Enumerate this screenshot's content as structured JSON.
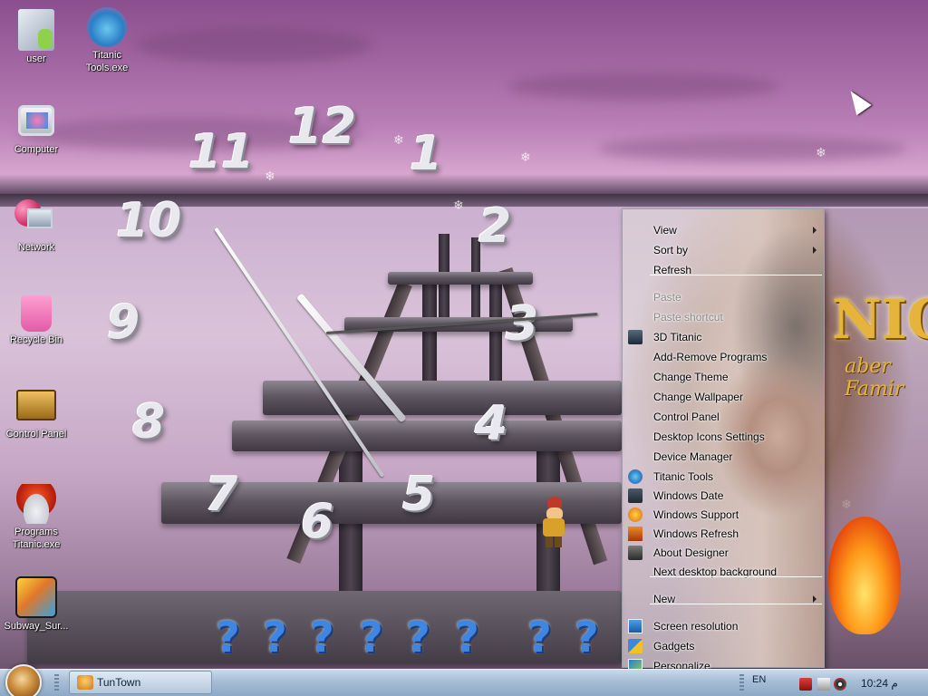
{
  "desktop": {
    "icons": [
      {
        "label": "user",
        "icon": "folder-user-icon"
      },
      {
        "label": "Titanic Tools.exe",
        "icon": "titanic-tools-icon"
      },
      {
        "label": "Computer",
        "icon": "computer-icon"
      },
      {
        "label": "Network",
        "icon": "network-icon"
      },
      {
        "label": "Recycle Bin",
        "icon": "recycle-bin-icon"
      },
      {
        "label": "Control Panel",
        "icon": "control-panel-icon"
      },
      {
        "label": "Programs Titanic.exe",
        "icon": "programs-icon"
      },
      {
        "label": "Subway_Sur...",
        "icon": "subway-surfers-icon"
      }
    ],
    "clock_numbers": [
      "12",
      "1",
      "2",
      "3",
      "4",
      "5",
      "6",
      "7",
      "8",
      "9",
      "10",
      "11"
    ],
    "question_marks": [
      "?",
      "?",
      "?",
      "?",
      "?",
      "?",
      "?",
      "?"
    ],
    "art_text": {
      "big": "NIC",
      "small": "aber Famir"
    }
  },
  "context_menu": {
    "items": [
      {
        "label": "View",
        "submenu": true,
        "disabled": false,
        "icon": ""
      },
      {
        "label": "Sort by",
        "submenu": true,
        "disabled": false,
        "icon": ""
      },
      {
        "label": "Refresh",
        "submenu": false,
        "disabled": false,
        "icon": ""
      },
      {
        "label": "Paste",
        "submenu": false,
        "disabled": true,
        "icon": ""
      },
      {
        "label": "Paste shortcut",
        "submenu": false,
        "disabled": true,
        "icon": ""
      },
      {
        "label": "3D Titanic",
        "submenu": false,
        "disabled": false,
        "icon": "titanic-3d-icon"
      },
      {
        "label": "Add-Remove Programs",
        "submenu": false,
        "disabled": false,
        "icon": ""
      },
      {
        "label": "Change Theme",
        "submenu": false,
        "disabled": false,
        "icon": ""
      },
      {
        "label": "Change Wallpaper",
        "submenu": false,
        "disabled": false,
        "icon": ""
      },
      {
        "label": "Control Panel",
        "submenu": false,
        "disabled": false,
        "icon": ""
      },
      {
        "label": "Desktop Icons Settings",
        "submenu": false,
        "disabled": false,
        "icon": ""
      },
      {
        "label": "Device Manager",
        "submenu": false,
        "disabled": false,
        "icon": ""
      },
      {
        "label": "Titanic Tools",
        "submenu": false,
        "disabled": false,
        "icon": "titanic-tools-icon"
      },
      {
        "label": "Windows Date",
        "submenu": false,
        "disabled": false,
        "icon": "windows-date-icon"
      },
      {
        "label": "Windows Support",
        "submenu": false,
        "disabled": false,
        "icon": "windows-support-icon"
      },
      {
        "label": "Windows Refresh",
        "submenu": false,
        "disabled": false,
        "icon": "windows-refresh-icon"
      },
      {
        "label": "About Designer",
        "submenu": false,
        "disabled": false,
        "icon": "about-designer-icon"
      },
      {
        "label": "Next desktop background",
        "submenu": false,
        "disabled": false,
        "icon": ""
      },
      {
        "label": "New",
        "submenu": true,
        "disabled": false,
        "icon": ""
      },
      {
        "label": "Screen resolution",
        "submenu": false,
        "disabled": false,
        "icon": "screen-resolution-icon"
      },
      {
        "label": "Gadgets",
        "submenu": false,
        "disabled": false,
        "icon": "gadgets-icon"
      },
      {
        "label": "Personalize",
        "submenu": false,
        "disabled": false,
        "icon": "personalize-icon"
      }
    ]
  },
  "taskbar": {
    "task_label": "TunTown",
    "language": "EN",
    "time": "10:24 م"
  },
  "colors": {
    "accent": "#3f86e0",
    "taskbar": "#a6bdd6"
  }
}
